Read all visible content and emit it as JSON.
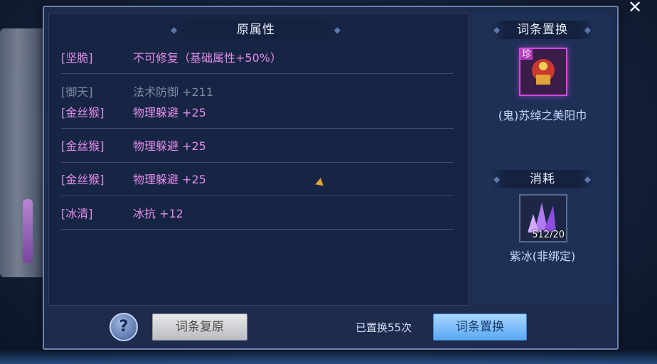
{
  "original_attributes": {
    "header": "原属性",
    "rows": [
      {
        "tag": "[坚脆]",
        "value": "不可修复（基础属性+50%）"
      },
      {
        "tag": "[御天]",
        "value": "法术防御 +211",
        "struck": true
      },
      {
        "tag": "[金丝猴]",
        "value": "物理躲避 +25"
      },
      {
        "tag": "[金丝猴]",
        "value": "物理躲避 +25"
      },
      {
        "tag": "[金丝猴]",
        "value": "物理躲避 +25"
      },
      {
        "tag": "[冰清]",
        "value": "冰抗 +12"
      }
    ]
  },
  "replace_panel": {
    "header": "词条置换",
    "item_name": "(鬼)苏绰之美阳巾",
    "rare_badge": "珍"
  },
  "cost_panel": {
    "header": "消耗",
    "item_name": "紫冰(非绑定)",
    "quantity": "512/20"
  },
  "footer": {
    "help_label": "?",
    "restore_button": "词条复原",
    "swap_count": "已置换55次",
    "swap_button": "词条置换"
  },
  "colors": {
    "attribute_text": "#e28ce8",
    "panel_bg": "#1d2b4d",
    "swap_button": "#5aa9f5"
  }
}
